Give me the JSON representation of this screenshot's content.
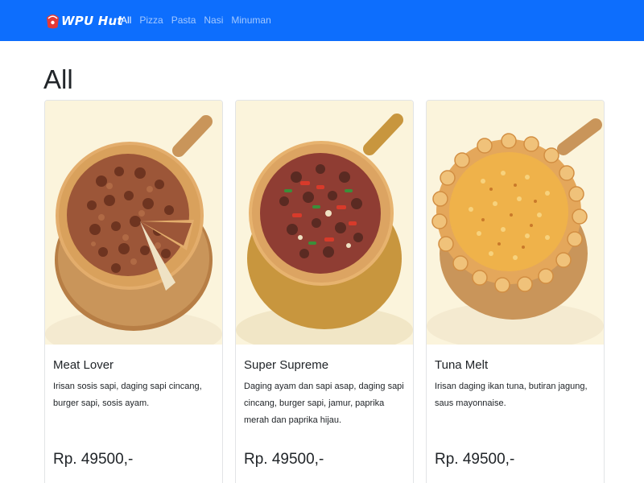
{
  "navbar": {
    "brand": "WPU Hut",
    "links": [
      {
        "label": "All",
        "active": true
      },
      {
        "label": "Pizza",
        "active": false
      },
      {
        "label": "Pasta",
        "active": false
      },
      {
        "label": "Nasi",
        "active": false
      },
      {
        "label": "Minuman",
        "active": false
      }
    ]
  },
  "page": {
    "title": "All"
  },
  "products": [
    {
      "name": "Meat Lover",
      "description": "Irisan sosis sapi, daging sapi cincang, burger sapi, sosis ayam.",
      "price": "Rp. 49500,-",
      "image": "pizza-meat-lover"
    },
    {
      "name": "Super Supreme",
      "description": "Daging ayam dan sapi asap, daging sapi cincang, burger sapi, jamur, paprika merah dan paprika hijau.",
      "price": "Rp. 49500,-",
      "image": "pizza-super-supreme"
    },
    {
      "name": "Tuna Melt",
      "description": "Irisan daging ikan tuna, butiran jagung, saus mayonnaise.",
      "price": "Rp. 49500,-",
      "image": "pizza-tuna-melt"
    }
  ],
  "colors": {
    "navbar": "#0d6efd",
    "crust": "#d9a15c",
    "meat": "#8a4a2e",
    "cheese": "#efb24a",
    "board": "#c9955a"
  }
}
